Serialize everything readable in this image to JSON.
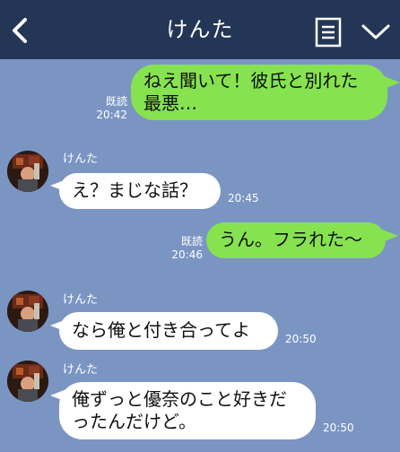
{
  "header": {
    "title": "けんた",
    "back_icon": "chevron-left-icon",
    "menu_icon": "list-icon",
    "dropdown_icon": "chevron-down-icon"
  },
  "colors": {
    "header_bg": "#243655",
    "chat_bg": "#7b95c3",
    "outgoing_bubble": "#86e34f",
    "incoming_bubble": "#ffffff"
  },
  "messages": [
    {
      "direction": "outgoing",
      "text_line1": "ねえ聞いて！彼氏と別れた",
      "text_line2": "最悪…",
      "read": "既読",
      "time": "20:42"
    },
    {
      "direction": "incoming",
      "sender": "けんた",
      "text": "え？まじな話？",
      "time": "20:45"
    },
    {
      "direction": "outgoing",
      "text": "うん。フラれた～",
      "read": "既読",
      "time": "20:46"
    },
    {
      "direction": "incoming",
      "sender": "けんた",
      "text": "なら俺と付き合ってよ",
      "time": "20:50"
    },
    {
      "direction": "incoming",
      "sender": "けんた",
      "text_line1": "俺ずっと優奈のこと好きだ",
      "text_line2": "ったんだけど。",
      "time": "20:50"
    }
  ]
}
